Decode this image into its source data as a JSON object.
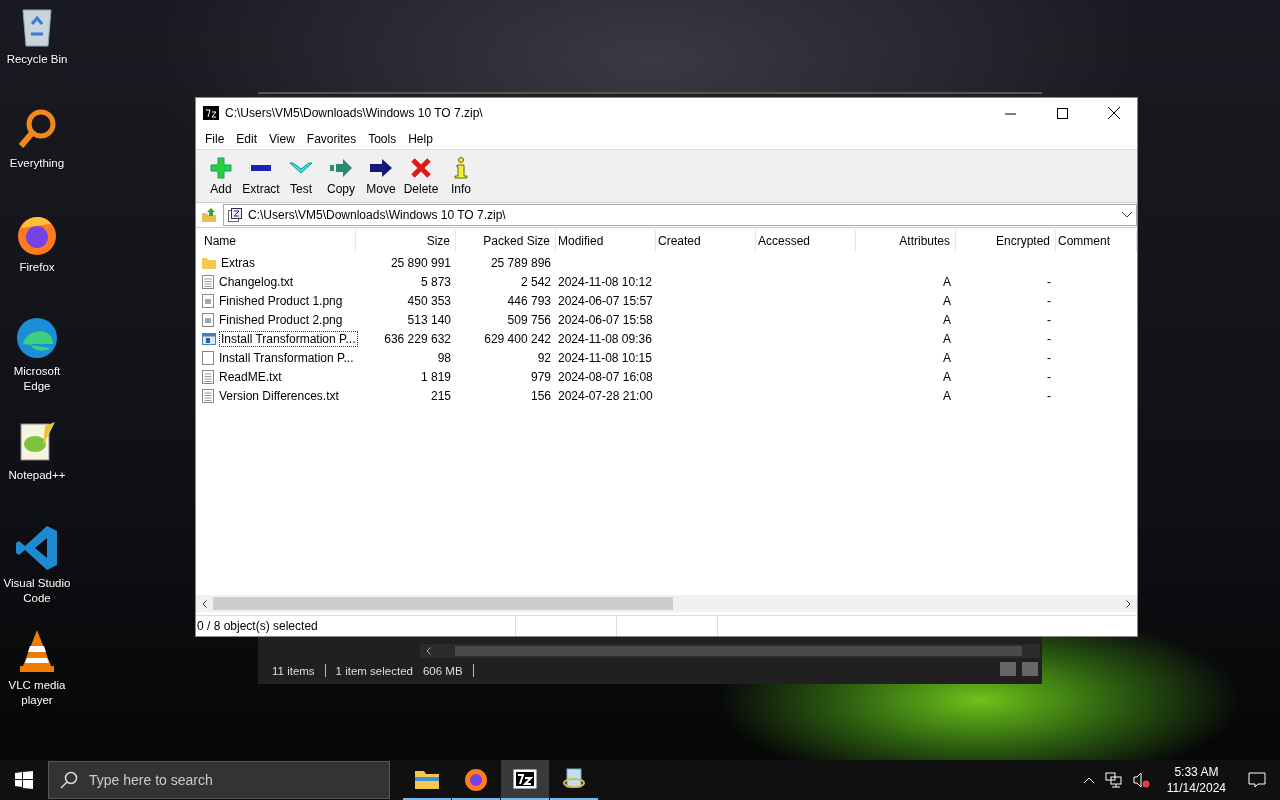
{
  "desktop_icons": [
    {
      "label": "Recycle Bin",
      "kind": "bin"
    },
    {
      "label": "Everything",
      "kind": "search"
    },
    {
      "label": "Firefox",
      "kind": "firefox"
    },
    {
      "label": "Microsoft Edge",
      "kind": "edge"
    },
    {
      "label": "Notepad++",
      "kind": "notepad"
    },
    {
      "label": "Visual Studio Code",
      "kind": "vscode"
    },
    {
      "label": "VLC media player",
      "kind": "vlc"
    }
  ],
  "background_window": {
    "status": [
      "11 items",
      "1 item selected",
      "606 MB"
    ]
  },
  "window": {
    "title": "C:\\Users\\VM5\\Downloads\\Windows 10 TO 7.zip\\",
    "menu": [
      "File",
      "Edit",
      "View",
      "Favorites",
      "Tools",
      "Help"
    ],
    "toolbar": [
      {
        "label": "Add",
        "kind": "add"
      },
      {
        "label": "Extract",
        "kind": "extract"
      },
      {
        "label": "Test",
        "kind": "test"
      },
      {
        "label": "Copy",
        "kind": "copy"
      },
      {
        "label": "Move",
        "kind": "move"
      },
      {
        "label": "Delete",
        "kind": "delete"
      },
      {
        "label": "Info",
        "kind": "info"
      }
    ],
    "address": "C:\\Users\\VM5\\Downloads\\Windows 10 TO 7.zip\\",
    "columns": [
      "Name",
      "Size",
      "Packed Size",
      "Modified",
      "Created",
      "Accessed",
      "Attributes",
      "Encrypted",
      "Comment"
    ],
    "rows": [
      {
        "kind": "folder",
        "name": "Extras",
        "size": "25 890 991",
        "packed": "25 789 896",
        "focused": false
      },
      {
        "kind": "text",
        "name": "Changelog.txt",
        "size": "5 873",
        "packed": "2 542",
        "modified": "2024-11-08 10:12",
        "attributes": "A",
        "encrypted": "-",
        "focused": false
      },
      {
        "kind": "image",
        "name": "Finished Product 1.png",
        "size": "450 353",
        "packed": "446 793",
        "modified": "2024-06-07 15:57",
        "attributes": "A",
        "encrypted": "-",
        "focused": false
      },
      {
        "kind": "image",
        "name": "Finished Product 2.png",
        "size": "513 140",
        "packed": "509 756",
        "modified": "2024-06-07 15:58",
        "attributes": "A",
        "encrypted": "-",
        "focused": false
      },
      {
        "kind": "app",
        "name": "Install Transformation P...",
        "size": "636 229 632",
        "packed": "629 400 242",
        "modified": "2024-11-08 09:36",
        "attributes": "A",
        "encrypted": "-",
        "focused": true
      },
      {
        "kind": "file",
        "name": "Install Transformation P...",
        "size": "98",
        "packed": "92",
        "modified": "2024-11-08 10:15",
        "attributes": "A",
        "encrypted": "-",
        "focused": false
      },
      {
        "kind": "text",
        "name": "ReadME.txt",
        "size": "1 819",
        "packed": "979",
        "modified": "2024-08-07 16:08",
        "attributes": "A",
        "encrypted": "-",
        "focused": false
      },
      {
        "kind": "text",
        "name": "Version Differences.txt",
        "size": "215",
        "packed": "156",
        "modified": "2024-07-28 21:00",
        "attributes": "A",
        "encrypted": "-",
        "focused": false
      }
    ],
    "status": "0 / 8 object(s) selected"
  },
  "taskbar": {
    "search_placeholder": "Type here to search",
    "apps": [
      {
        "kind": "folder",
        "active": false
      },
      {
        "kind": "firefox",
        "active": false
      },
      {
        "kind": "sevenzip",
        "active": true
      },
      {
        "kind": "installer",
        "active": false
      }
    ],
    "time": "5:33 AM",
    "date": "11/14/2024"
  }
}
